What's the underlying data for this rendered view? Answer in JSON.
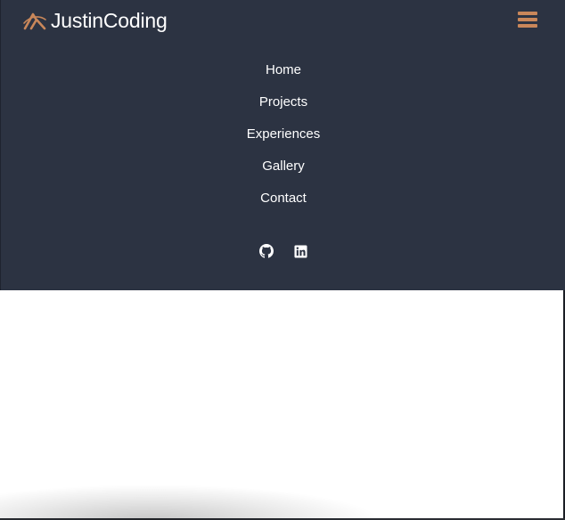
{
  "brand": {
    "name": "JustinCoding",
    "logo_icon": "mountain-logo-icon",
    "accent_color": "#c9875a"
  },
  "menu_toggle": {
    "icon": "hamburger-menu-icon"
  },
  "nav": {
    "items": [
      {
        "label": "Home"
      },
      {
        "label": "Projects"
      },
      {
        "label": "Experiences"
      },
      {
        "label": "Gallery"
      },
      {
        "label": "Contact"
      }
    ]
  },
  "social": {
    "items": [
      {
        "icon": "github-icon"
      },
      {
        "icon": "linkedin-icon"
      }
    ]
  },
  "colors": {
    "navbar_background": "#2c3342",
    "text": "#ffffff",
    "page_background": "#ffffff"
  }
}
